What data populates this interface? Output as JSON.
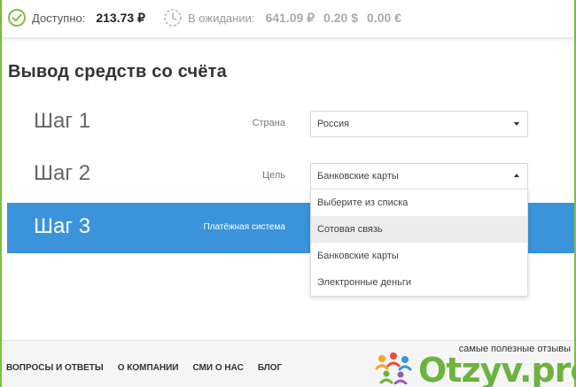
{
  "balance": {
    "available_label": "Доступно:",
    "available_amount": "213.73 ₽",
    "pending_label": "В ожидании:",
    "pending_rub": "641.09 ₽",
    "pending_usd": "0.20 $",
    "pending_eur": "0.00 €"
  },
  "page_title": "Вывод средств со счёта",
  "steps": [
    {
      "label": "Шаг 1",
      "field_label": "Страна",
      "value": "Россия"
    },
    {
      "label": "Шаг 2",
      "field_label": "Цель",
      "value": "Банковские карты"
    },
    {
      "label": "Шаг 3",
      "field_label": "Платёжная система"
    }
  ],
  "dropdown": {
    "options": [
      "Выберите из списка",
      "Сотовая связь",
      "Банковские карты",
      "Электронные деньги"
    ],
    "hovered_index": 1
  },
  "footer": {
    "links": [
      "ВОПРОСЫ И ОТВЕТЫ",
      "О КОМПАНИИ",
      "СМИ О НАС",
      "БЛОГ"
    ]
  },
  "watermark": {
    "tagline": "самые полезные отзывы",
    "logo": "Otzyv.pro"
  },
  "colors": {
    "accent_blue": "#3b93db",
    "ok_green": "#7cc142",
    "brand_green": "#6cb33f"
  },
  "icons": {
    "available": "check-circle-icon",
    "pending": "clock-icon"
  }
}
